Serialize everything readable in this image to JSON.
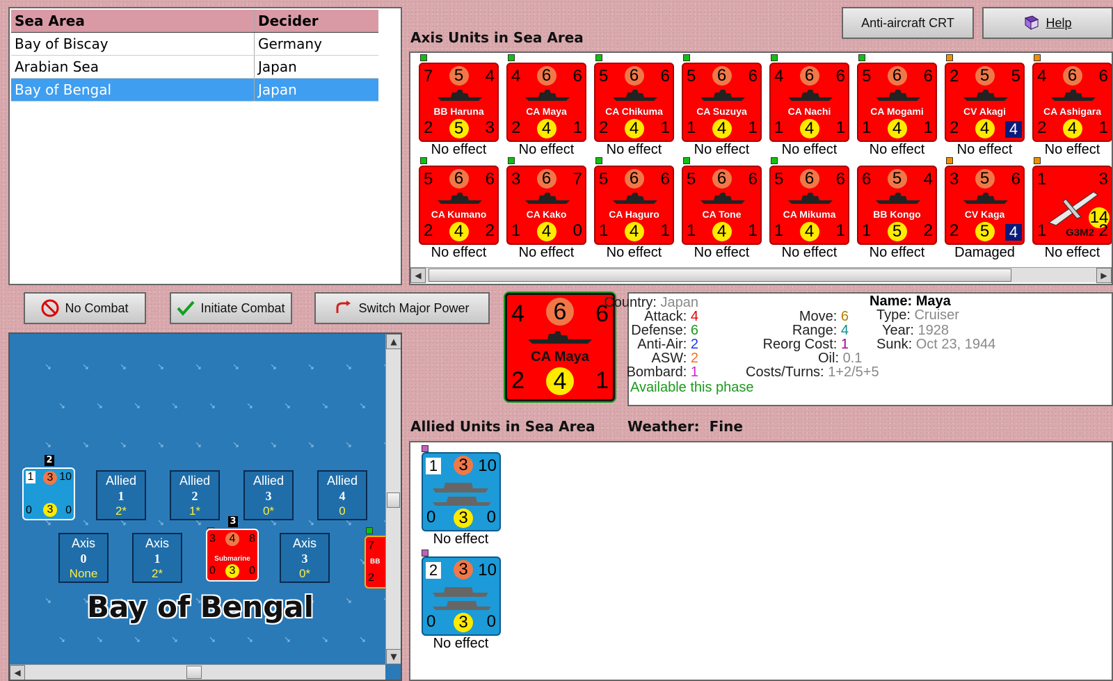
{
  "sea_table": {
    "headers": [
      "Sea Area",
      "Decider"
    ],
    "rows": [
      {
        "area": "Bay of Biscay",
        "decider": "Germany"
      },
      {
        "area": "Arabian Sea",
        "decider": "Japan"
      },
      {
        "area": "Bay of Bengal",
        "decider": "Japan",
        "selected": true
      }
    ]
  },
  "toolbar": {
    "anti_aircraft_label": "Anti-aircraft CRT",
    "help_label": "Help",
    "no_combat_label": "No Combat",
    "initiate_combat_label": "Initiate Combat",
    "switch_power_label": "Switch Major Power"
  },
  "axis_section_title": "Axis Units in Sea Area",
  "allied_section_title": "Allied Units in Sea Area",
  "weather_label": "Weather:",
  "weather_value": "Fine",
  "axis_units": [
    {
      "name": "BB Haruna",
      "tl": "7",
      "tc": "5",
      "tr": "4",
      "bl": "2",
      "bc": "5",
      "br": "3",
      "status": "No effect",
      "marker": "green"
    },
    {
      "name": "CA Maya",
      "tl": "4",
      "tc": "6",
      "tr": "6",
      "bl": "2",
      "bc": "4",
      "br": "1",
      "status": "No effect",
      "marker": "green"
    },
    {
      "name": "CA Chikuma",
      "tl": "5",
      "tc": "6",
      "tr": "6",
      "bl": "2",
      "bc": "4",
      "br": "1",
      "status": "No effect",
      "marker": "green"
    },
    {
      "name": "CA Suzuya",
      "tl": "5",
      "tc": "6",
      "tr": "6",
      "bl": "1",
      "bc": "4",
      "br": "1",
      "status": "No effect",
      "marker": "green"
    },
    {
      "name": "CA Nachi",
      "tl": "4",
      "tc": "6",
      "tr": "6",
      "bl": "1",
      "bc": "4",
      "br": "1",
      "status": "No effect",
      "marker": "green"
    },
    {
      "name": "CA Mogami",
      "tl": "5",
      "tc": "6",
      "tr": "6",
      "bl": "1",
      "bc": "4",
      "br": "1",
      "status": "No effect",
      "marker": "green"
    },
    {
      "name": "CV Akagi",
      "tl": "2",
      "tc": "5",
      "tr": "5",
      "bl": "2",
      "bc": "4",
      "br": "4",
      "status": "No effect",
      "marker": "orange",
      "badge": true
    },
    {
      "name": "CA Ashigara",
      "tl": "4",
      "tc": "6",
      "tr": "6",
      "bl": "2",
      "bc": "4",
      "br": "1",
      "status": "No effect",
      "marker": "orange"
    },
    {
      "name": "CA Kumano",
      "tl": "5",
      "tc": "6",
      "tr": "6",
      "bl": "2",
      "bc": "4",
      "br": "2",
      "status": "No effect",
      "marker": "green"
    },
    {
      "name": "CA Kako",
      "tl": "3",
      "tc": "6",
      "tr": "7",
      "bl": "1",
      "bc": "4",
      "br": "0",
      "status": "No effect",
      "marker": "green"
    },
    {
      "name": "CA Haguro",
      "tl": "5",
      "tc": "6",
      "tr": "6",
      "bl": "1",
      "bc": "4",
      "br": "1",
      "status": "No effect",
      "marker": "green"
    },
    {
      "name": "CA Tone",
      "tl": "5",
      "tc": "6",
      "tr": "6",
      "bl": "1",
      "bc": "4",
      "br": "1",
      "status": "No effect",
      "marker": "green"
    },
    {
      "name": "CA Mikuma",
      "tl": "5",
      "tc": "6",
      "tr": "6",
      "bl": "1",
      "bc": "4",
      "br": "1",
      "status": "No effect",
      "marker": "green"
    },
    {
      "name": "BB Kongo",
      "tl": "6",
      "tc": "5",
      "tr": "4",
      "bl": "1",
      "bc": "5",
      "br": "2",
      "status": "No effect",
      "marker": "none"
    },
    {
      "name": "CV Kaga",
      "tl": "3",
      "tc": "5",
      "tr": "6",
      "bl": "2",
      "bc": "5",
      "br": "4",
      "status": "Damaged",
      "marker": "orange",
      "badge": true
    },
    {
      "name": "G3M2",
      "tl": "1",
      "tc": "",
      "tr": "3",
      "bl": "1",
      "bc": "14",
      "br": "2",
      "status": "No effect",
      "marker": "orange",
      "plane": true
    }
  ],
  "selected_unit": {
    "tl": "4",
    "tc": "6",
    "tr": "6",
    "name": "CA Maya",
    "bl": "2",
    "bc": "4",
    "br": "1"
  },
  "details": {
    "country_label": "Country:",
    "country": "Japan",
    "attack_label": "Attack:",
    "attack": "4",
    "defense_label": "Defense:",
    "defense": "6",
    "antiair_label": "Anti-Air:",
    "antiair": "2",
    "asw_label": "ASW:",
    "asw": "2",
    "bombard_label": "Bombard:",
    "bombard": "1",
    "availability": "Available this phase",
    "move_label": "Move:",
    "move": "6",
    "range_label": "Range:",
    "range": "4",
    "reorg_label": "Reorg Cost:",
    "reorg": "1",
    "oil_label": "Oil:",
    "oil": "0.1",
    "costs_label": "Costs/Turns:",
    "costs": "1+2/5+5",
    "name_label": "Name:",
    "name": "Maya",
    "type_label": "Type:",
    "type": "Cruiser",
    "year_label": "Year:",
    "year": "1928",
    "sunk_label": "Sunk:",
    "sunk": "Oct 23, 1944",
    "colors": {
      "attack": "#e00000",
      "defense": "#1a9a1a",
      "antiair": "#1a3ae0",
      "asw": "#f07020",
      "bombard": "#d020d0",
      "move": "#b08000",
      "range": "#10908a",
      "reorg": "#a000a0",
      "grey": "#888888",
      "avail": "#1a9a1a"
    }
  },
  "allied_units": [
    {
      "tl": "1",
      "tc": "3",
      "tr": "10",
      "bl": "0",
      "bc": "3",
      "br": "0",
      "status": "No effect"
    },
    {
      "tl": "2",
      "tc": "3",
      "tr": "10",
      "bl": "0",
      "bc": "3",
      "br": "0",
      "status": "No effect"
    }
  ],
  "map": {
    "area_name": "Bay of Bengal",
    "stack_count": "2",
    "mini_unit": {
      "tl": "1",
      "tc": "3",
      "tr": "10",
      "bl": "0",
      "bc": "3",
      "br": "0"
    },
    "allied_boxes": [
      {
        "title": "Allied",
        "num": "1",
        "val": "2*"
      },
      {
        "title": "Allied",
        "num": "2",
        "val": "1*"
      },
      {
        "title": "Allied",
        "num": "3",
        "val": "0*"
      },
      {
        "title": "Allied",
        "num": "4",
        "val": "0"
      }
    ],
    "axis_boxes": [
      {
        "title": "Axis",
        "num": "0",
        "val": "None"
      },
      {
        "title": "Axis",
        "num": "1",
        "val": "2*"
      },
      {
        "title": "Axis",
        "num": "3",
        "val": "0*"
      }
    ],
    "sub_unit": {
      "count": "3",
      "tl": "3",
      "tc": "4",
      "tr": "8",
      "name": "Submarine",
      "bl": "0",
      "bc": "3",
      "br": "0"
    },
    "partial_unit": {
      "tl": "7",
      "name": "BB",
      "bl": "2"
    }
  }
}
